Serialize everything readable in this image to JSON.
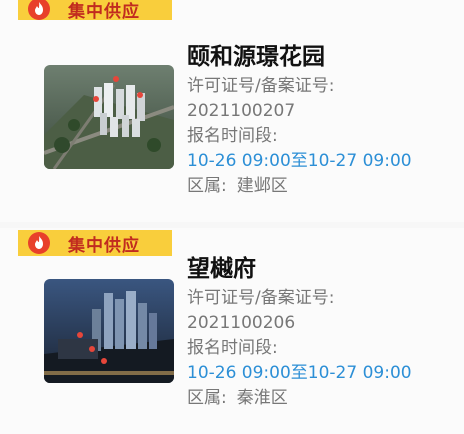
{
  "listings": [
    {
      "badge": "集中供应",
      "name": "颐和源璟花园",
      "license_label": "许可证号/备案证号:",
      "license_number": "2021100207",
      "period_label": "报名时间段:",
      "period_value": "10-26 09:00至10-27 09:00",
      "district_label": "区属:",
      "district_value": "建邺区"
    },
    {
      "badge": "集中供应",
      "name": "望樾府",
      "license_label": "许可证号/备案证号:",
      "license_number": "2021100206",
      "period_label": "报名时间段:",
      "period_value": "10-26 09:00至10-27 09:00",
      "district_label": "区属:",
      "district_value": "秦淮区"
    }
  ],
  "colors": {
    "badge_bg": "#f9ce3c",
    "badge_text": "#c12b1f",
    "flame": "#e8402a",
    "time_text": "#2c8fd6",
    "label_text": "#777777",
    "title_text": "#111111"
  },
  "icons": {
    "badge_icon": "flame-icon"
  }
}
